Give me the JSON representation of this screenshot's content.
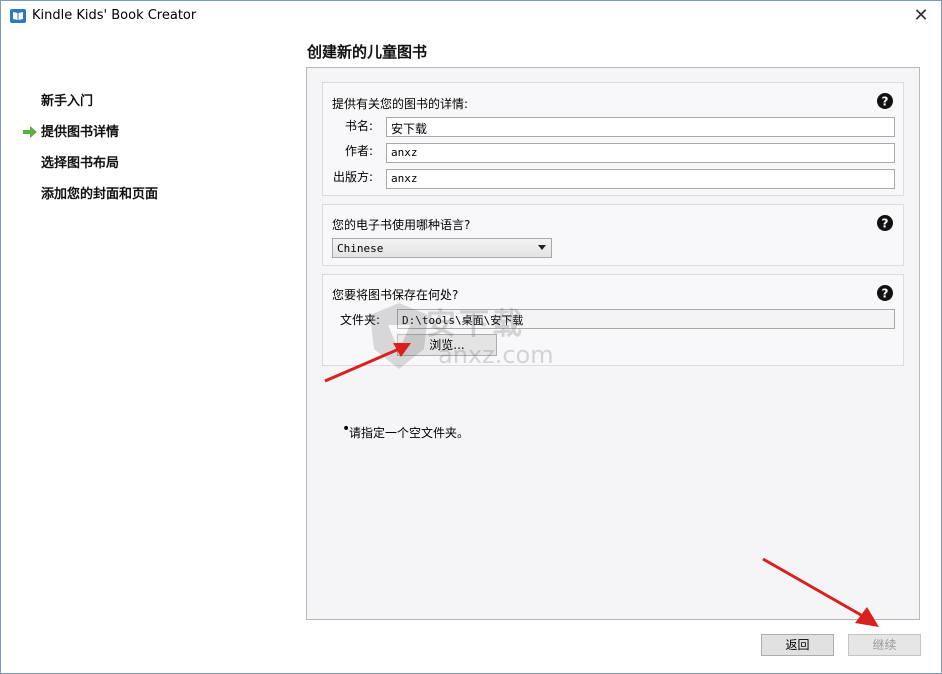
{
  "window": {
    "title": "Kindle Kids' Book Creator",
    "close_glyph": "✕"
  },
  "sidebar": {
    "items": [
      {
        "label": "新手入门",
        "active": false
      },
      {
        "label": "提供图书详情",
        "active": true
      },
      {
        "label": "选择图书布局",
        "active": false
      },
      {
        "label": "添加您的封面和页面",
        "active": false
      }
    ]
  },
  "page": {
    "title": "创建新的儿童图书"
  },
  "details_group": {
    "label": "提供有关您的图书的详情:",
    "fields": [
      {
        "label": "书名:",
        "value": "安下载"
      },
      {
        "label": "作者:",
        "value": "anxz"
      },
      {
        "label": "出版方:",
        "value": "anxz"
      }
    ]
  },
  "language_group": {
    "label": "您的电子书使用哪种语言?",
    "selected": "Chinese"
  },
  "save_group": {
    "label": "您要将图书保存在何处?",
    "folder_label": "文件夹:",
    "folder_value": "D:\\tools\\桌面\\安下载",
    "browse_label": "浏览..."
  },
  "hint": {
    "text": "请指定一个空文件夹。"
  },
  "footer": {
    "back_label": "返回",
    "continue_label": "继续"
  },
  "watermark": {
    "cn": "安下载",
    "en": "anxz.com"
  },
  "colors": {
    "arrow": "#d9201c",
    "nav_arrow": "#5cad3c",
    "border": "#b8b8b8"
  }
}
